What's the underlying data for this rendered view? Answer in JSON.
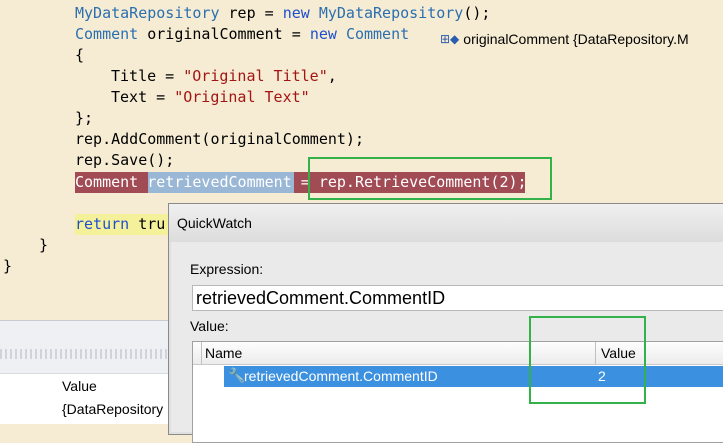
{
  "code": {
    "line1_type": "MyDataRepository",
    "line1_mid": " rep = ",
    "line1_kw": "new",
    "line1_type2": "MyDataRepository",
    "line1_end": "();",
    "line2_type": "Comment",
    "line2_mid": " originalComment = ",
    "line2_kw": "new",
    "line2_type2": "Comment",
    "line3": "{",
    "line4_a": "Title = ",
    "line4_str": "\"Original Title\"",
    "line4_b": ",",
    "line5_a": "Text = ",
    "line5_str": "\"Original Text\"",
    "line6": "};",
    "line7": "rep.AddComment(originalComment);",
    "line8": "rep.Save();",
    "line9_type": "Comment",
    "line9_var": "retrievedComment",
    "line9_eq": " = ",
    "line9_call": "rep.RetrieveComment(2);",
    "line10_kw": "return",
    "line10_rest": " tru",
    "line11": "}",
    "line12": "}"
  },
  "datatip": {
    "icon": "expand-plus-icon",
    "label": "originalComment {DataRepository.M"
  },
  "locals_panel": {
    "value_header": "Value",
    "value_cell": "{DataRepository"
  },
  "quickwatch": {
    "title": "QuickWatch",
    "expression_label": "Expression:",
    "expression_value": "retrievedComment.CommentID",
    "value_label": "Value:",
    "columns": [
      "Name",
      "Value"
    ],
    "rows": [
      {
        "name": "retrievedComment.CommentID",
        "value": "2",
        "icon": "wrench-property-icon"
      }
    ]
  },
  "colors": {
    "editor_bg": "#f5ecd3",
    "keyword": "#1f4fcf",
    "string": "#a31515",
    "breakpoint_line": "#a14b55",
    "annotation_box": "#34b24a",
    "selected_row": "#3c90e0"
  }
}
